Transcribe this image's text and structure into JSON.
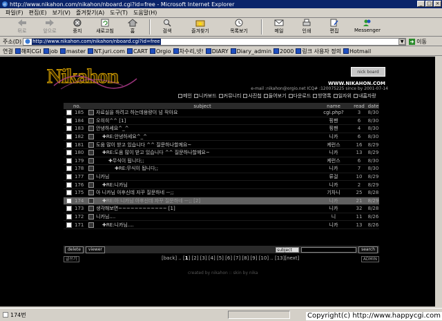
{
  "window": {
    "title": "http://www.nikahon.com/nikahon/nboard.cgi?id=free - Microsoft Internet Explorer",
    "minimize": "_",
    "maximize": "□",
    "close": "×"
  },
  "menu": [
    "파일(F)",
    "편집(E)",
    "보기(V)",
    "즐겨찾기(A)",
    "도구(T)",
    "도움말(H)"
  ],
  "toolbar": {
    "back": "뒤로",
    "forward": "앞으로",
    "stop": "중지",
    "refresh": "새로고침",
    "home": "홈",
    "search": "검색",
    "favorites": "즐겨찾기",
    "history": "목록보기",
    "mail": "메일",
    "print": "인쇄",
    "edit": "편집",
    "messenger": "Messenger"
  },
  "address": {
    "label": "주소(D)",
    "url": "http://www.nikahon.com/nikahon/nboard.cgi?id=free",
    "go": "이동"
  },
  "links": {
    "label": "연결",
    "items": [
      "해피CGI",
      "job",
      "master",
      "NT.juri.com",
      "CART",
      "Orgio",
      "차수리,넷!",
      "DIARY",
      "Diary_admin",
      "2000",
      "링크 사용자 정의",
      "Hotmail"
    ]
  },
  "site": {
    "logo": "Nikahon",
    "nick_board": "nick board",
    "url": "WWW.NIKAHON.COM",
    "email_line": "e-mail :nikahon@orgio.net ICQ# :120075225 since by 2001-07-14",
    "nav": [
      "메인",
      "니카보드",
      "커뮤니티",
      "사진첩",
      "들어보기",
      "다운로드",
      "방명록",
      "일자위",
      "내홈자랑"
    ]
  },
  "board": {
    "headers": {
      "no": "no.",
      "subject": "subject",
      "name": "name",
      "read": "read",
      "date": "date"
    },
    "rows": [
      {
        "no": "185",
        "subject": "자료실을 하려고 하는데용량이 넘 작아요",
        "name": "cgi.php?",
        "read": "3",
        "date": "8/30",
        "depth": 0
      },
      {
        "no": "184",
        "subject": "오히히^^ [1]",
        "name": "핑팬",
        "read": "6",
        "date": "8/30",
        "depth": 0
      },
      {
        "no": "183",
        "subject": "안녕하세요^_^",
        "name": "핑팬",
        "read": "4",
        "date": "8/30",
        "depth": 0
      },
      {
        "no": "182",
        "subject": "RE:안녕하세요^_^",
        "name": "니카",
        "read": "6",
        "date": "8/30",
        "depth": 1
      },
      {
        "no": "181",
        "subject": "도움 많이 받고 있습니다 ^^ 질문하나할께요~",
        "name": "케런스",
        "read": "16",
        "date": "8/29",
        "depth": 0
      },
      {
        "no": "180",
        "subject": "RE:도움 많이 받고 있습니다 ^^ 질문하나할께요~",
        "name": "니카",
        "read": "13",
        "date": "8/29",
        "depth": 1
      },
      {
        "no": "179",
        "subject": "무식이 됩니다;;",
        "name": "케런스",
        "read": "6",
        "date": "8/30",
        "depth": 2
      },
      {
        "no": "178",
        "subject": "RE:무식이 됩니다;;",
        "name": "니카",
        "read": "7",
        "date": "8/30",
        "depth": 3
      },
      {
        "no": "177",
        "subject": "니카님",
        "name": "류걸",
        "read": "10",
        "date": "8/29",
        "depth": 0
      },
      {
        "no": "176",
        "subject": "RE:니카님",
        "name": "니카",
        "read": "2",
        "date": "8/29",
        "depth": 1
      },
      {
        "no": "175",
        "subject": "아 니카님 아후신데 자꾸 질문하네 ㅡ;;",
        "name": "기차니",
        "read": "25",
        "date": "8/28",
        "depth": 0
      },
      {
        "no": "174",
        "subject": "RE:아 니카님 아후신데 자꾸 질문하네 ㅡ;; [2]",
        "name": "니카",
        "read": "21",
        "date": "8/29",
        "depth": 1,
        "highlight": true
      },
      {
        "no": "173",
        "subject": "생각해보면~~~~~~~~~~~~ [1]",
        "name": "니카",
        "read": "32",
        "date": "8/28",
        "depth": 0
      },
      {
        "no": "172",
        "subject": "니카님....",
        "name": "니",
        "read": "11",
        "date": "8/26",
        "depth": 0
      },
      {
        "no": "171",
        "subject": "RE:니카님....",
        "name": "니카",
        "read": "13",
        "date": "8/26",
        "depth": 1
      }
    ],
    "delete": "delete",
    "viewer": "viewer",
    "search_field": "subject",
    "search_btn": "search",
    "write": "글쓰기",
    "admin": "ADMIN",
    "pager_prefix": "[back] .. [",
    "current_page": "1",
    "pager_rest": "] [2] [3] [4] [5] [6] [7] [8] [9] [10] .. [13][next]",
    "credit": "created by nikahon :: skin by nika"
  },
  "status": {
    "text": "174번",
    "copyright": "Copyright(c) http://www.happycgi.com"
  }
}
